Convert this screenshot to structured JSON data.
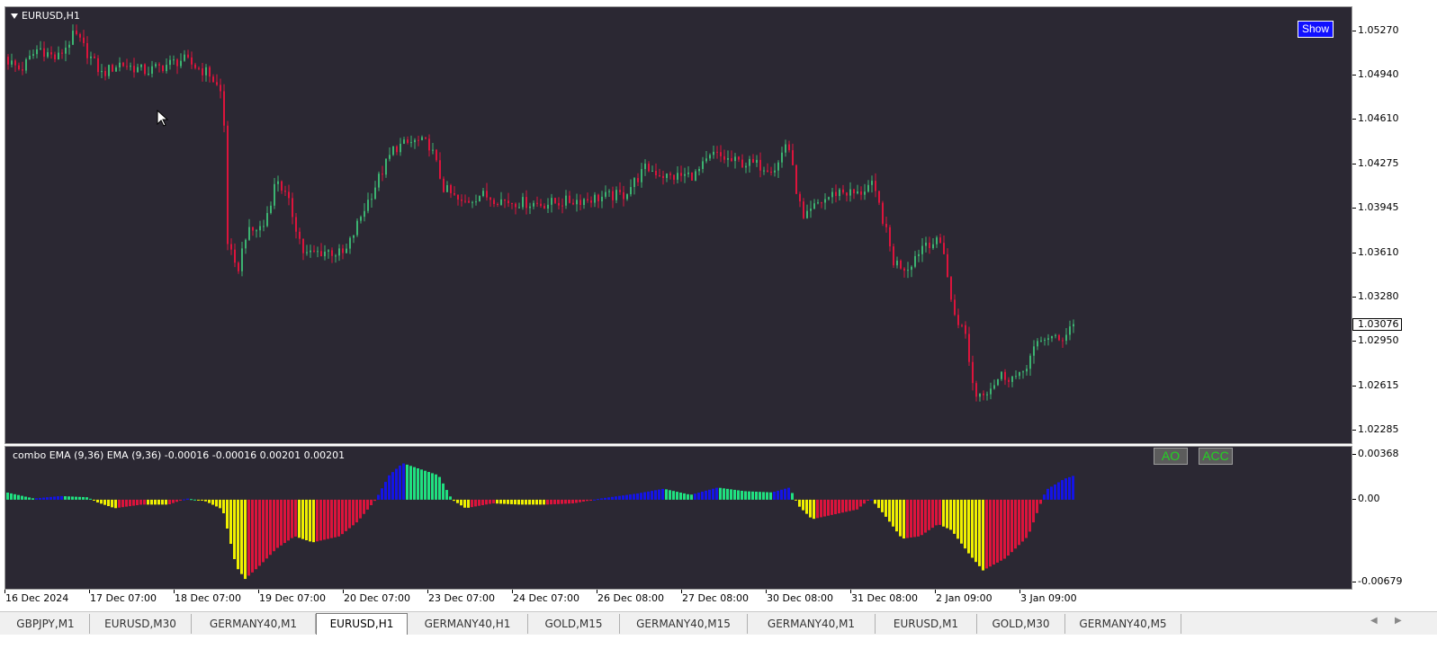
{
  "chart": {
    "symbol_label": "EURUSD,H1",
    "show_button": "Show",
    "price_scale": [
      "1.05270",
      "1.04940",
      "1.04610",
      "1.04275",
      "1.03945",
      "1.03610",
      "1.03280",
      "1.02950",
      "1.02615",
      "1.02285"
    ],
    "current_price": "1.03076"
  },
  "indicator": {
    "label": "combo EMA (9,36) EMA (9,36)  -0.00016 -0.00016 0.00201 0.00201",
    "ao_button": "AO",
    "acc_button": "ACC",
    "scale": [
      "0.00368",
      "0.00",
      "-0.00679"
    ]
  },
  "time_axis": [
    "16 Dec 2024",
    "17 Dec 07:00",
    "18 Dec 07:00",
    "19 Dec 07:00",
    "20 Dec 07:00",
    "23 Dec 07:00",
    "24 Dec 07:00",
    "26 Dec 08:00",
    "27 Dec 08:00",
    "30 Dec 08:00",
    "31 Dec 08:00",
    "2 Jan 09:00",
    "3 Jan 09:00"
  ],
  "tabs": [
    {
      "label": "GBPJPY,M1",
      "active": false
    },
    {
      "label": "EURUSD,M30",
      "active": false
    },
    {
      "label": "GERMANY40,M1",
      "active": false
    },
    {
      "label": "EURUSD,H1",
      "active": true
    },
    {
      "label": "GERMANY40,H1",
      "active": false
    },
    {
      "label": "GOLD,M15",
      "active": false
    },
    {
      "label": "GERMANY40,M15",
      "active": false
    },
    {
      "label": "GERMANY40,M1",
      "active": false
    },
    {
      "label": "EURUSD,M1",
      "active": false
    },
    {
      "label": "GOLD,M30",
      "active": false
    },
    {
      "label": "GERMANY40,M5",
      "active": false
    }
  ],
  "colors": {
    "background": "#2b2833",
    "bull": "#3cb371",
    "bear": "#dc143c",
    "hist_blue": "#1414e6",
    "hist_green": "#20e080",
    "hist_yellow": "#f0f000",
    "hist_red": "#dc143c"
  },
  "chart_data": {
    "type": "candlestick",
    "price_path": [
      [
        0,
        1.0508
      ],
      [
        20,
        1.0498
      ],
      [
        40,
        1.0515
      ],
      [
        60,
        1.0506
      ],
      [
        80,
        1.0525
      ],
      [
        110,
        1.0495
      ],
      [
        130,
        1.0503
      ],
      [
        160,
        1.0497
      ],
      [
        200,
        1.0506
      ],
      [
        230,
        1.0495
      ],
      [
        245,
        1.0478
      ],
      [
        250,
        1.037
      ],
      [
        260,
        1.0345
      ],
      [
        270,
        1.0375
      ],
      [
        290,
        1.0382
      ],
      [
        305,
        1.0418
      ],
      [
        320,
        1.0395
      ],
      [
        335,
        1.036
      ],
      [
        360,
        1.0363
      ],
      [
        380,
        1.036
      ],
      [
        400,
        1.0392
      ],
      [
        420,
        1.042
      ],
      [
        435,
        1.044
      ],
      [
        460,
        1.0445
      ],
      [
        475,
        1.0442
      ],
      [
        490,
        1.041
      ],
      [
        510,
        1.0398
      ],
      [
        530,
        1.0405
      ],
      [
        560,
        1.04
      ],
      [
        600,
        1.0398
      ],
      [
        640,
        1.0401
      ],
      [
        690,
        1.0405
      ],
      [
        715,
        1.0425
      ],
      [
        740,
        1.0418
      ],
      [
        770,
        1.042
      ],
      [
        790,
        1.0435
      ],
      [
        810,
        1.043
      ],
      [
        830,
        1.0428
      ],
      [
        860,
        1.0425
      ],
      [
        872,
        1.0447
      ],
      [
        880,
        1.0415
      ],
      [
        890,
        1.0385
      ],
      [
        905,
        1.0398
      ],
      [
        930,
        1.0408
      ],
      [
        950,
        1.0405
      ],
      [
        965,
        1.0413
      ],
      [
        975,
        1.0395
      ],
      [
        990,
        1.0355
      ],
      [
        1005,
        1.035
      ],
      [
        1025,
        1.037
      ],
      [
        1045,
        1.0368
      ],
      [
        1055,
        1.032
      ],
      [
        1070,
        1.03
      ],
      [
        1080,
        1.0255
      ],
      [
        1095,
        1.026
      ],
      [
        1110,
        1.027
      ],
      [
        1130,
        1.0268
      ],
      [
        1145,
        1.0288
      ],
      [
        1160,
        1.03
      ],
      [
        1175,
        1.0295
      ],
      [
        1187,
        1.0308
      ]
    ],
    "ylim": [
      1.0218,
      1.0545
    ],
    "hist_path": [
      [
        0,
        0.0006
      ],
      [
        30,
        0.0001
      ],
      [
        60,
        0.0003
      ],
      [
        90,
        0.0002
      ],
      [
        100,
        -0.0002
      ],
      [
        120,
        -0.0007
      ],
      [
        150,
        -0.0004
      ],
      [
        180,
        -0.0004
      ],
      [
        200,
        0.0001
      ],
      [
        220,
        -0.0001
      ],
      [
        240,
        -0.0008
      ],
      [
        255,
        -0.0055
      ],
      [
        265,
        -0.0065
      ],
      [
        280,
        -0.0055
      ],
      [
        300,
        -0.004
      ],
      [
        320,
        -0.003
      ],
      [
        340,
        -0.0035
      ],
      [
        370,
        -0.003
      ],
      [
        390,
        -0.0018
      ],
      [
        410,
        0.0
      ],
      [
        425,
        0.002
      ],
      [
        440,
        0.003
      ],
      [
        460,
        0.0025
      ],
      [
        480,
        0.002
      ],
      [
        495,
        0.0
      ],
      [
        510,
        -0.0007
      ],
      [
        540,
        -0.0003
      ],
      [
        570,
        -0.0004
      ],
      [
        600,
        -0.0004
      ],
      [
        630,
        -0.0003
      ],
      [
        660,
        0.0001
      ],
      [
        700,
        0.0005
      ],
      [
        730,
        0.0009
      ],
      [
        760,
        0.0004
      ],
      [
        790,
        0.001
      ],
      [
        820,
        0.0007
      ],
      [
        850,
        0.0006
      ],
      [
        870,
        0.001
      ],
      [
        880,
        -0.0005
      ],
      [
        895,
        -0.0016
      ],
      [
        920,
        -0.0012
      ],
      [
        945,
        -0.0008
      ],
      [
        960,
        0.0001
      ],
      [
        975,
        -0.0012
      ],
      [
        995,
        -0.0032
      ],
      [
        1015,
        -0.003
      ],
      [
        1035,
        -0.002
      ],
      [
        1050,
        -0.0025
      ],
      [
        1070,
        -0.0045
      ],
      [
        1085,
        -0.0058
      ],
      [
        1110,
        -0.0048
      ],
      [
        1135,
        -0.003
      ],
      [
        1155,
        0.0008
      ],
      [
        1175,
        0.0017
      ],
      [
        1187,
        0.002
      ]
    ],
    "hist_ylim": [
      -0.00679,
      0.00368
    ]
  }
}
